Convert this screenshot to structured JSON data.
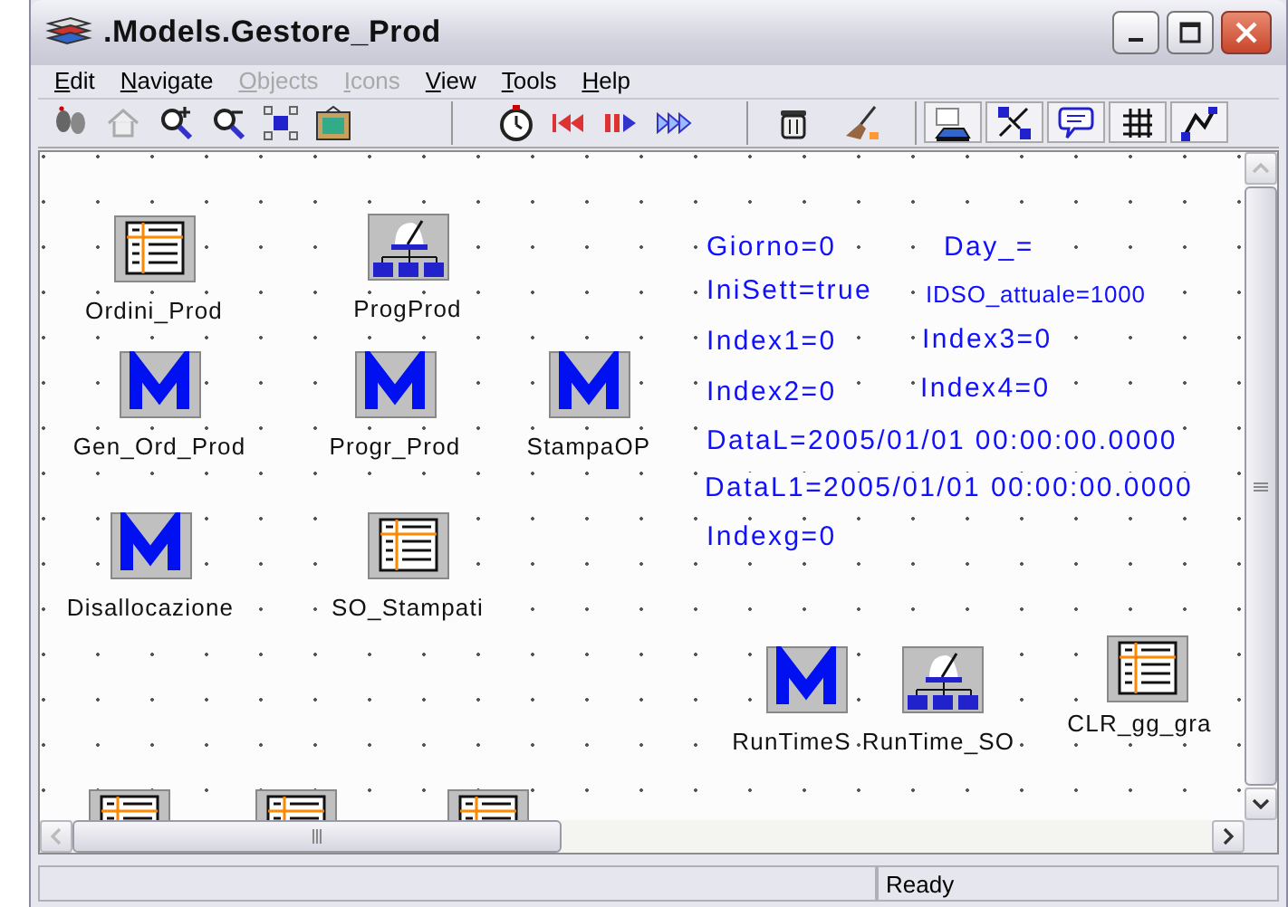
{
  "window": {
    "title": ".Models.Gestore_Prod"
  },
  "menu": [
    {
      "label": "Edit",
      "disabled": false
    },
    {
      "label": "Navigate",
      "disabled": false
    },
    {
      "label": "Objects",
      "disabled": true
    },
    {
      "label": "Icons",
      "disabled": true
    },
    {
      "label": "View",
      "disabled": false
    },
    {
      "label": "Tools",
      "disabled": false
    },
    {
      "label": "Help",
      "disabled": false
    }
  ],
  "canvas": {
    "objects": [
      {
        "kind": "table",
        "label": "Ordini_Prod"
      },
      {
        "kind": "program",
        "label": "ProgProd"
      },
      {
        "kind": "module",
        "label": "Gen_Ord_Prod"
      },
      {
        "kind": "module",
        "label": "Progr_Prod"
      },
      {
        "kind": "module",
        "label": "StampaOP"
      },
      {
        "kind": "module",
        "label": "Disallocazione"
      },
      {
        "kind": "table",
        "label": "SO_Stampati"
      },
      {
        "kind": "module",
        "label": "RunTimeS"
      },
      {
        "kind": "program",
        "label": "RunTime_SO"
      },
      {
        "kind": "table",
        "label": "CLR_gg_gra"
      },
      {
        "kind": "table"
      },
      {
        "kind": "table"
      },
      {
        "kind": "table"
      }
    ],
    "variables": [
      {
        "text": "Giorno=0",
        "kind": "normal"
      },
      {
        "text": "Day_=",
        "kind": "normal"
      },
      {
        "text": "IniSett=true",
        "kind": "normal"
      },
      {
        "text": "IDSO_attuale=1000",
        "kind": "small"
      },
      {
        "text": "Index1=0",
        "kind": "normal"
      },
      {
        "text": "Index3=0",
        "kind": "normal"
      },
      {
        "text": "Index2=0",
        "kind": "normal"
      },
      {
        "text": "Index4=0",
        "kind": "normal"
      },
      {
        "text": "DataL=2005/01/01 00:00:00.0000",
        "kind": "normal"
      },
      {
        "text": "DataL1=2005/01/01 00:00:00.0000",
        "kind": "normal"
      },
      {
        "text": "Indexg=0",
        "kind": "normal"
      }
    ]
  },
  "status_bar": {
    "text": "Ready"
  }
}
